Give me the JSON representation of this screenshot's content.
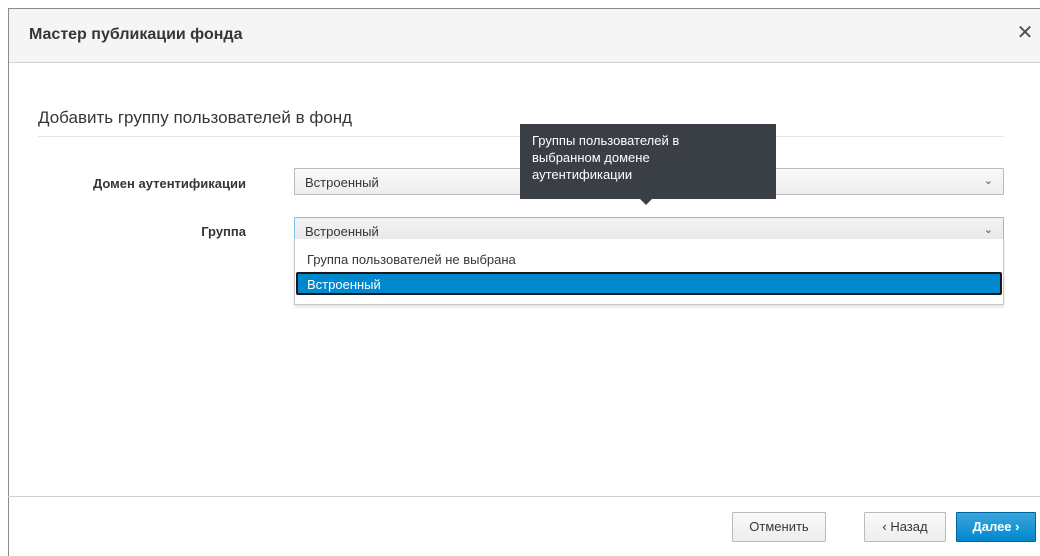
{
  "dialog": {
    "title": "Мастер публикации фонда",
    "close_glyph": "✕"
  },
  "section": {
    "title": "Добавить группу пользователей в фонд"
  },
  "fields": {
    "domain": {
      "label": "Домен аутентификации",
      "value": "Встроенный",
      "chevron": "⌄"
    },
    "group": {
      "label": "Группа",
      "value": "Встроенный",
      "chevron": "⌄"
    }
  },
  "dropdown": {
    "options": [
      "Группа пользователей не выбрана",
      "Встроенный"
    ],
    "selected": "Встроенный"
  },
  "tooltip": {
    "lines": [
      "Группы пользователей в",
      "выбранном домене",
      "аутентификации"
    ]
  },
  "footer": {
    "cancel_label": "Отменить",
    "back_label": "‹ Назад",
    "next_label": "Далее ›"
  },
  "colors": {
    "primary": "#0088ce",
    "tooltip_bg": "#393f44",
    "header_bg": "#f5f5f5"
  }
}
